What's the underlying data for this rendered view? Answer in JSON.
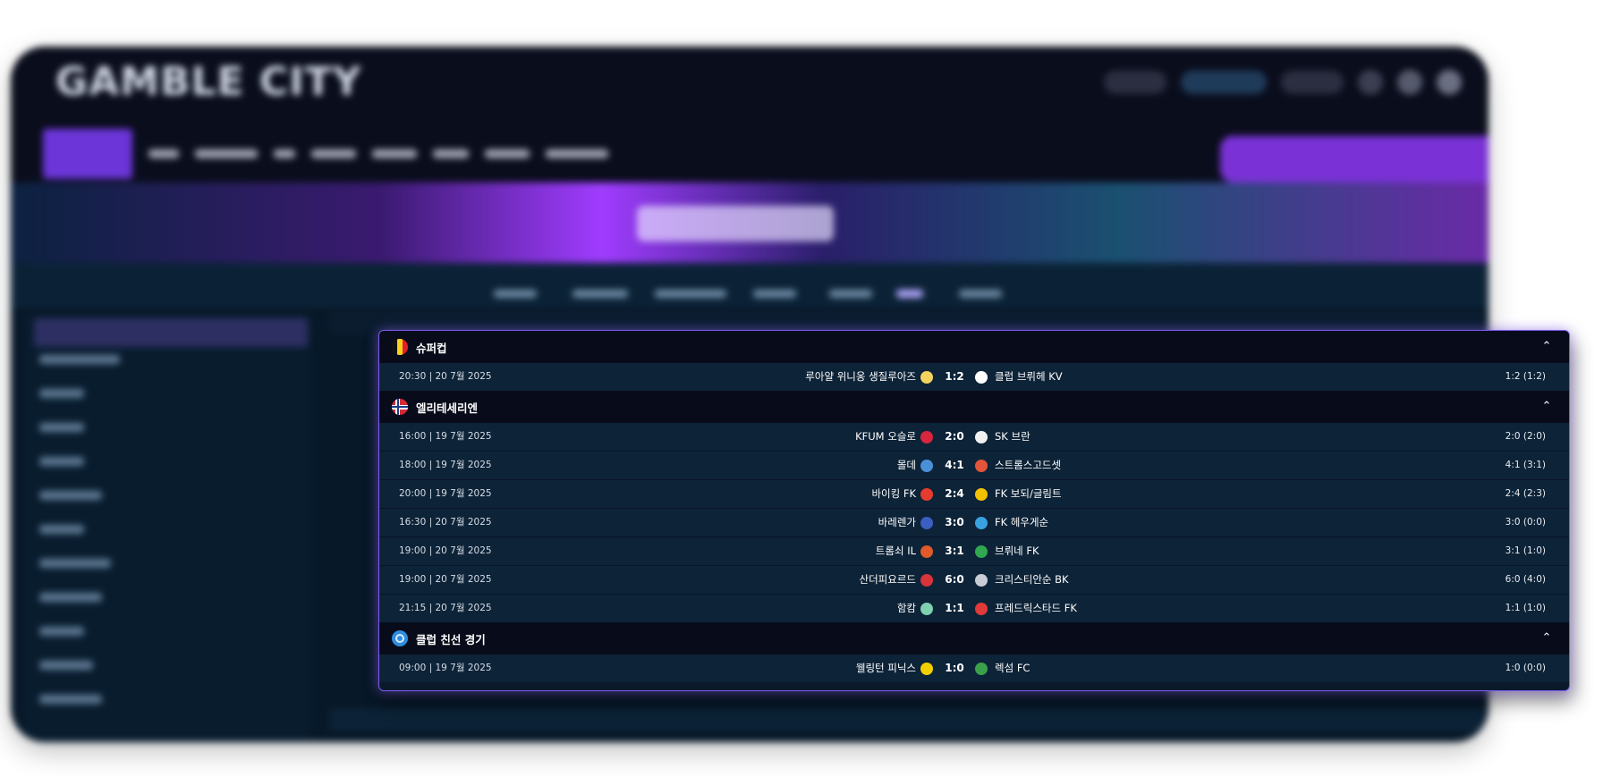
{
  "background_site": {
    "logo_text": "GAMBLE CITY"
  },
  "leagues": [
    {
      "name": "슈퍼컵",
      "flag_icon": "belgium-flag-icon",
      "matches": [
        {
          "time": "20:30 | 20 7월 2025",
          "home": "루아얄 위니옹 생질루아즈",
          "score": "1:2",
          "away": "클럽 브뤼헤 KV",
          "final": "1:2 (1:2)",
          "home_color": "#f4d35e",
          "away_color": "#ffffff"
        }
      ]
    },
    {
      "name": "엘리테세리엔",
      "flag_icon": "norway-flag-icon",
      "matches": [
        {
          "time": "16:00 | 19 7월 2025",
          "home": "KFUM 오슬로",
          "score": "2:0",
          "away": "SK 브란",
          "final": "2:0 (2:0)",
          "home_color": "#d7263d",
          "away_color": "#f1f1f1"
        },
        {
          "time": "18:00 | 19 7월 2025",
          "home": "몰데",
          "score": "4:1",
          "away": "스트롬스고드셋",
          "final": "4:1 (3:1)",
          "home_color": "#4a90d9",
          "away_color": "#e2553a"
        },
        {
          "time": "20:00 | 19 7월 2025",
          "home": "바이킹 FK",
          "score": "2:4",
          "away": "FK 보되/글림트",
          "final": "2:4 (2:3)",
          "home_color": "#e63b2e",
          "away_color": "#f2c200"
        },
        {
          "time": "16:30 | 20 7월 2025",
          "home": "바레렌가",
          "score": "3:0",
          "away": "FK 헤우게순",
          "final": "3:0 (0:0)",
          "home_color": "#3b5fc0",
          "away_color": "#3aa0e0"
        },
        {
          "time": "19:00 | 20 7월 2025",
          "home": "트롬쇠 IL",
          "score": "3:1",
          "away": "브뤼네 FK",
          "final": "3:1 (1:0)",
          "home_color": "#e05a2a",
          "away_color": "#2fa84f"
        },
        {
          "time": "19:00 | 20 7월 2025",
          "home": "산더피요르드",
          "score": "6:0",
          "away": "크리스티안순 BK",
          "final": "6:0 (4:0)",
          "home_color": "#d8343a",
          "away_color": "#c8ccd4"
        },
        {
          "time": "21:15 | 20 7월 2025",
          "home": "함캄",
          "score": "1:1",
          "away": "프레드릭스타드 FK",
          "final": "1:1 (1:0)",
          "home_color": "#7fd0b0",
          "away_color": "#e03a3a"
        }
      ]
    },
    {
      "name": "클럽 친선 경기",
      "flag_icon": "club-friendly-icon",
      "matches": [
        {
          "time": "09:00 | 19 7월 2025",
          "home": "웰링턴 피닉스",
          "score": "1:0",
          "away": "렉섬 FC",
          "final": "1:0 (0:0)",
          "home_color": "#f2d000",
          "away_color": "#3aa04a"
        }
      ]
    }
  ],
  "collapse_symbol": "⌃"
}
